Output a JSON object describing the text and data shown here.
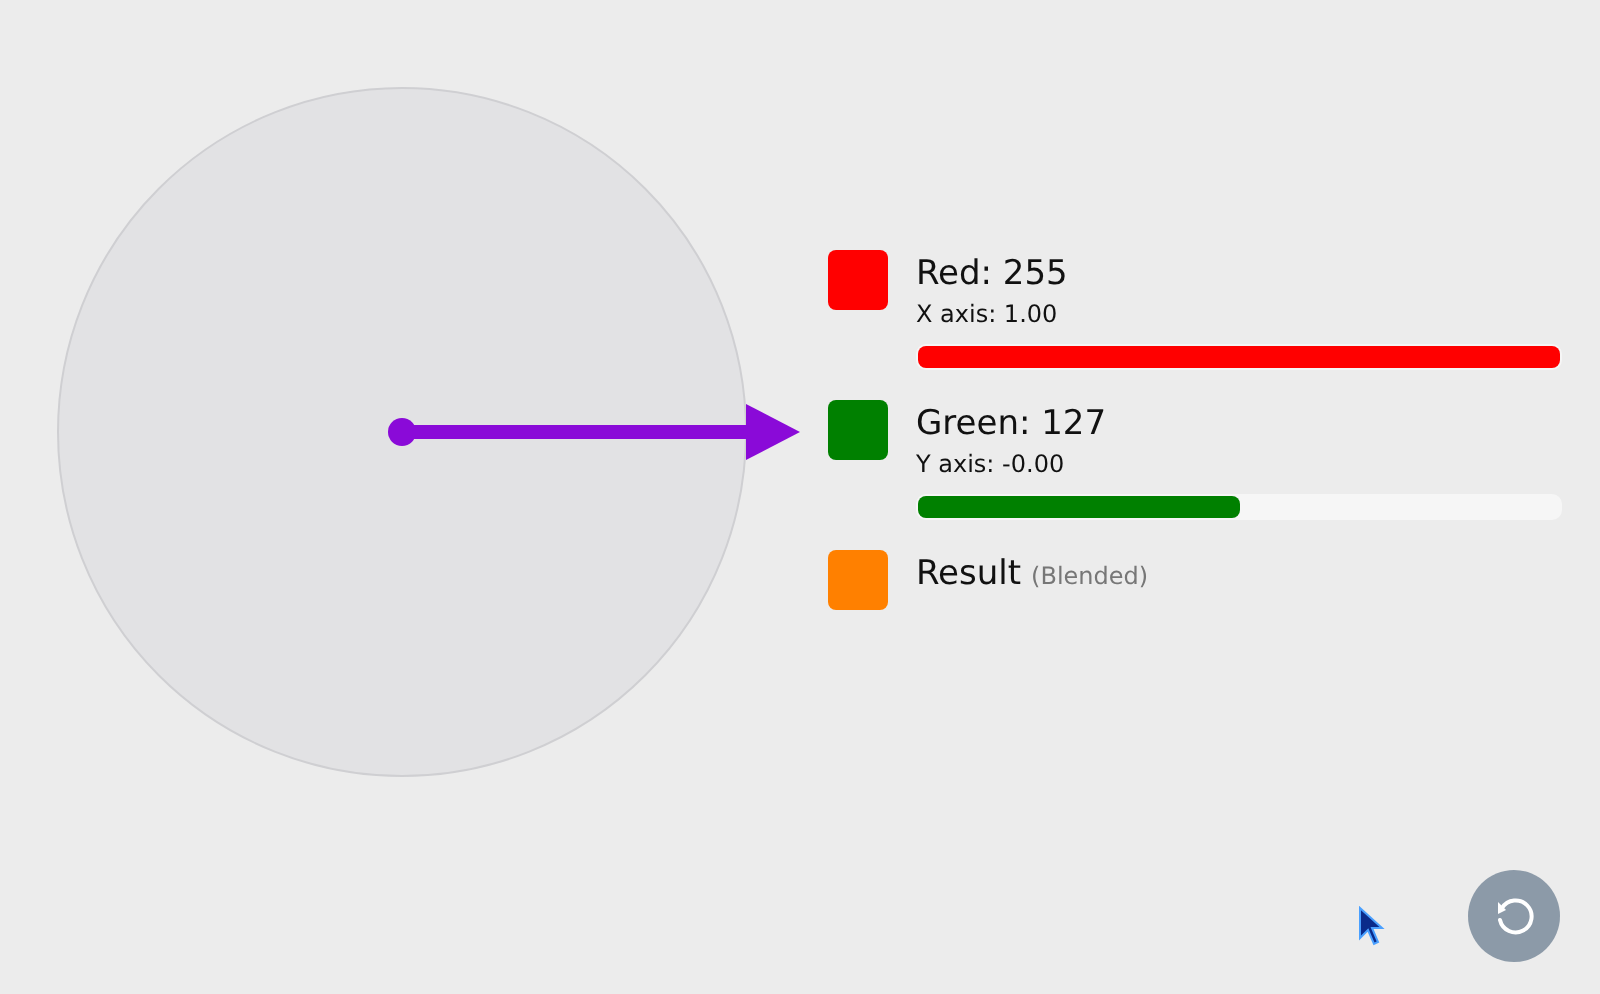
{
  "legend": [
    {
      "kind": "channel",
      "label": "Red: 255",
      "axis": "X axis: 1.00",
      "level": 1.0,
      "color": "#ff0000"
    },
    {
      "kind": "channel",
      "label": "Green: 127",
      "axis": "Y axis: -0.00",
      "level": 0.5,
      "color": "#008000"
    },
    {
      "kind": "result",
      "label": "Result",
      "note": "(Blended)",
      "color": "#ff8000"
    }
  ]
}
